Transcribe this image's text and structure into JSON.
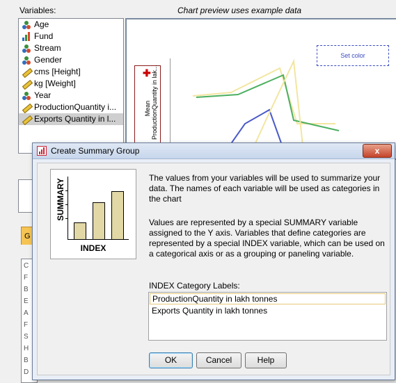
{
  "main": {
    "variables_label": "Variables:",
    "preview_note": "Chart preview uses example data",
    "set_color": "Set color",
    "y_axis_title_top": "Mean",
    "y_axis_title_bottom": "ProductionQuantity in lak...",
    "variables": [
      {
        "label": "Age",
        "icon": "nominal-icon",
        "selected": false
      },
      {
        "label": "Fund",
        "icon": "ordinal-icon",
        "selected": false
      },
      {
        "label": "Stream",
        "icon": "nominal-icon",
        "selected": false
      },
      {
        "label": "Gender",
        "icon": "nominal-icon",
        "selected": false
      },
      {
        "label": "cms [Height]",
        "icon": "scale-icon",
        "selected": false
      },
      {
        "label": "kg [Weight]",
        "icon": "scale-icon",
        "selected": false
      },
      {
        "label": "Year",
        "icon": "nominal-icon",
        "selected": false
      },
      {
        "label": "ProductionQuantity i...",
        "icon": "scale-icon",
        "selected": false
      },
      {
        "label": "Exports Quantity in l...",
        "icon": "scale-icon",
        "selected": true
      }
    ],
    "gallery_tab_letter": "G",
    "strip_letters": [
      "C",
      "F",
      "B",
      "E",
      "A",
      "F",
      "S",
      "H",
      "B",
      "D"
    ],
    "preview_line_colors": [
      "#f2e6a0",
      "#4caf60",
      "#4a5ac8"
    ]
  },
  "dialog": {
    "title": "Create Summary Group",
    "close_glyph": "x",
    "image": {
      "y_label": "SUMMARY",
      "x_label": "INDEX"
    },
    "paragraph1": "The values from your variables will be used to summarize your data. The names of each variable will be used as categories in the chart",
    "paragraph2": "Values are represented by a special SUMMARY variable assigned to the Y axis. Variables that define categories are represented by a special INDEX variable, which can be used on a categorical axis or as a grouping or paneling variable.",
    "category_labels_heading": "INDEX Category Labels:",
    "categories": [
      "ProductionQuantity in lakh tonnes",
      "Exports Quantity in lakh tonnes"
    ],
    "buttons": {
      "ok": "OK",
      "cancel": "Cancel",
      "help": "Help"
    }
  }
}
